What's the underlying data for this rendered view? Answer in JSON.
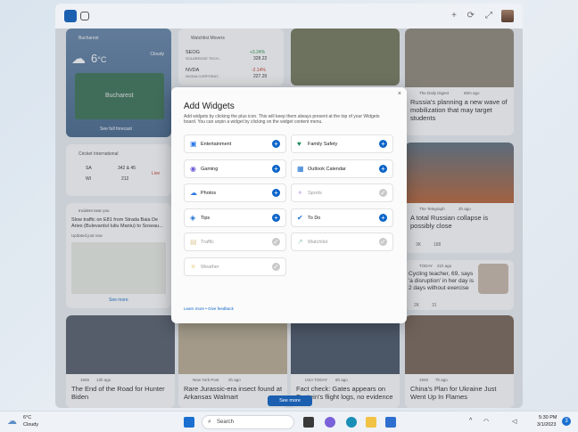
{
  "tabs": {
    "home": "home-tab",
    "video": "video-tab"
  },
  "weather": {
    "city": "Bucharest",
    "temp": "6",
    "unit": "°C",
    "condition": "Cloudy",
    "forecast_link": "See full forecast",
    "map_label": "Bucharest"
  },
  "watchlist": {
    "title": "Watchlist Movers",
    "rows": [
      {
        "ticker": "SEOG",
        "name": "SOLAREDGE TECH...",
        "change": "+3.24%",
        "price": "328.22"
      },
      {
        "ticker": "NVDA",
        "name": "NVIDIA CORPORAT...",
        "change": "-2.14%",
        "price": "227.20"
      }
    ]
  },
  "cricket": {
    "title": "Cricket International",
    "teams": [
      {
        "code": "SA",
        "score": "342 & 45",
        "status": "Live"
      },
      {
        "code": "WI",
        "score": "212",
        "status": ""
      }
    ]
  },
  "traffic": {
    "title": "Incident near you",
    "headline": "Slow traffic on E81 from Strada Baia De Aries (Bulevardul Iuliu Maniu) to Soseau...",
    "updated": "Updated just now",
    "see_more": "See more"
  },
  "dialog": {
    "title": "Add Widgets",
    "description": "Add widgets by clicking the plus icon. This will keep them always present at the top of your Widgets board. You can unpin a widget by clicking on the widget content menu.",
    "close": "×",
    "footer": "Learn more • Give feedback",
    "widgets": [
      {
        "label": "Entertainment",
        "icon": "film-icon",
        "enabled": true
      },
      {
        "label": "Family Safety",
        "icon": "heart-icon",
        "enabled": true
      },
      {
        "label": "Gaming",
        "icon": "gamepad-icon",
        "enabled": true
      },
      {
        "label": "Outlook Calendar",
        "icon": "calendar-icon",
        "enabled": true
      },
      {
        "label": "Photos",
        "icon": "cloud-icon",
        "enabled": true
      },
      {
        "label": "Sports",
        "icon": "sports-icon",
        "enabled": false
      },
      {
        "label": "Tips",
        "icon": "lightbulb-icon",
        "enabled": true
      },
      {
        "label": "To Do",
        "icon": "check-icon",
        "enabled": true
      },
      {
        "label": "Traffic",
        "icon": "traffic-icon",
        "enabled": false
      },
      {
        "label": "Watchlist",
        "icon": "chart-icon",
        "enabled": false
      },
      {
        "label": "Weather",
        "icon": "sun-icon",
        "enabled": false
      }
    ]
  },
  "news": [
    {
      "source": "The Daily Digest",
      "time": "60m ago",
      "headline": "Russia's planning a new wave of mobilization that may target students"
    },
    {
      "source": "The Telegraph",
      "time": "2h ago",
      "headline": "A total Russian collapse is possibly close",
      "likes": "3K",
      "comments": "188"
    },
    {
      "source": "TODAY",
      "time": "21h ago",
      "headline": "Cycling teacher, 69, says 'a disruption' in her day is 2 days without exercise",
      "likes": "2K",
      "comments": "31"
    },
    {
      "source": "1945",
      "time": "13h ago",
      "headline": "The End of the Road for Hunter Biden"
    },
    {
      "source": "New York Post",
      "time": "2h ago",
      "headline": "Rare Jurassic-era insect found at Arkansas Walmart"
    },
    {
      "source": "USA TODAY",
      "time": "6h ago",
      "headline": "Fact check: Gates appears on Epstein's flight logs, no evidence"
    },
    {
      "source": "1945",
      "time": "7h ago",
      "headline": "China's Plan for Ukraine Just Went Up In Flames"
    }
  ],
  "see_more_button": "See more",
  "taskbar": {
    "weather_temp": "6°C",
    "weather_cond": "Cloudy",
    "search": "Search",
    "time": "5:30 PM",
    "date": "3/1/2023",
    "badge": "3"
  }
}
